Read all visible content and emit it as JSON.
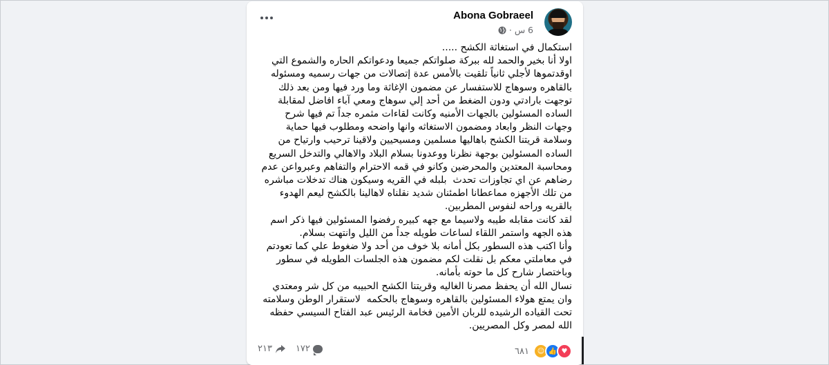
{
  "post": {
    "author": "Abona Gobraeel",
    "time": "6 س",
    "separator": "·",
    "text": "استكمال في استغاثة الكشح .....\nاولا أنا بخير والحمد لله ببركة صلواتكم جميعا ودعواتكم الحاره والشموع التي اوقدتموها لأجلي ثانياً تلقيت بالأمس عدة إتصالات من جهات رسميه ومسئوله بالقاهره وسوهاج للاستفسار عن مضمون الإغاثة وما ورد فيها ومن بعد ذلك توجهت بارادتي ودون الضغط من أحد إلي سوهاج ومعي آباء افاضل لمقابلة الساده المسئولين بالجهات الأمنيه وكانت لقاءات مثمره جداً تم فيها شرح وجهات النظر وابعاد ومضمون الاستغاثه وانها واضحه ومطلوب فيها حماية وسلامة قريتنا الكشح باهاليها مسلمين ومسيحيين ولاقينا ترحيب وارتياح من الساده المسئولين بوجهة نظرنا ووعدونا بسلام البلاد والاهالي والتدخل السريع ومحاسبة المعتدين والمحرضين وكانو في قمه الاحترام والتفاهم وعبرواعن عدم رضاهم عن اي تجاوزات تحدث  بلبله في القريه وسيكون هناك تدخلات مباشره من تلك الأجهزه مماعطانا اطمئنان شديد نقلناه لاهالينا بالكشح ليعم الهدوء بالقريه وراحه لنفوس المطربين.\nلقد كانت مقابله طيبه ولاسيما مع جهه كبيره رفضوا المسئولين فيها ذكر اسم هذه الجهه واستمر اللقاء لساعات طويله جداً من الليل وانتهت بسلام.\nوأنا اكتب هذه السطور بكل أمانه بلا خوف من أحد ولا ضغوط علي كما تعودتم في معاملتي معكم بل نقلت لكم مضمون هذه الجلسات الطويله في سطور وباختصار شارح كل ما حوته بأمانه.\nنسال الله أن يحفظ مصرنا الغاليه وقريتنا الكشح الحبيبه من كل شر ومعتدي وان يمتع هولاء المسئولين بالقاهره وسوهاج بالحكمه  لاستقرار الوطن وسلامته تحت القياده الرشيده للربان الأمين فخامة الرئيس عبد الفتاح السيسي حفظه الله لمصر وكل المصريين."
  },
  "footer": {
    "reactions_count": "٦٨١",
    "comments_count": "١٧٢",
    "shares_count": "٢١٣"
  },
  "colors": {
    "like": "#1877f2",
    "love": "#f33e58",
    "care": "#f7b125",
    "secondary_text": "#65676b"
  },
  "icons": [
    "more-options-icon",
    "globe-icon",
    "love-reaction-icon",
    "like-reaction-icon",
    "care-reaction-icon",
    "comment-icon",
    "share-icon"
  ]
}
